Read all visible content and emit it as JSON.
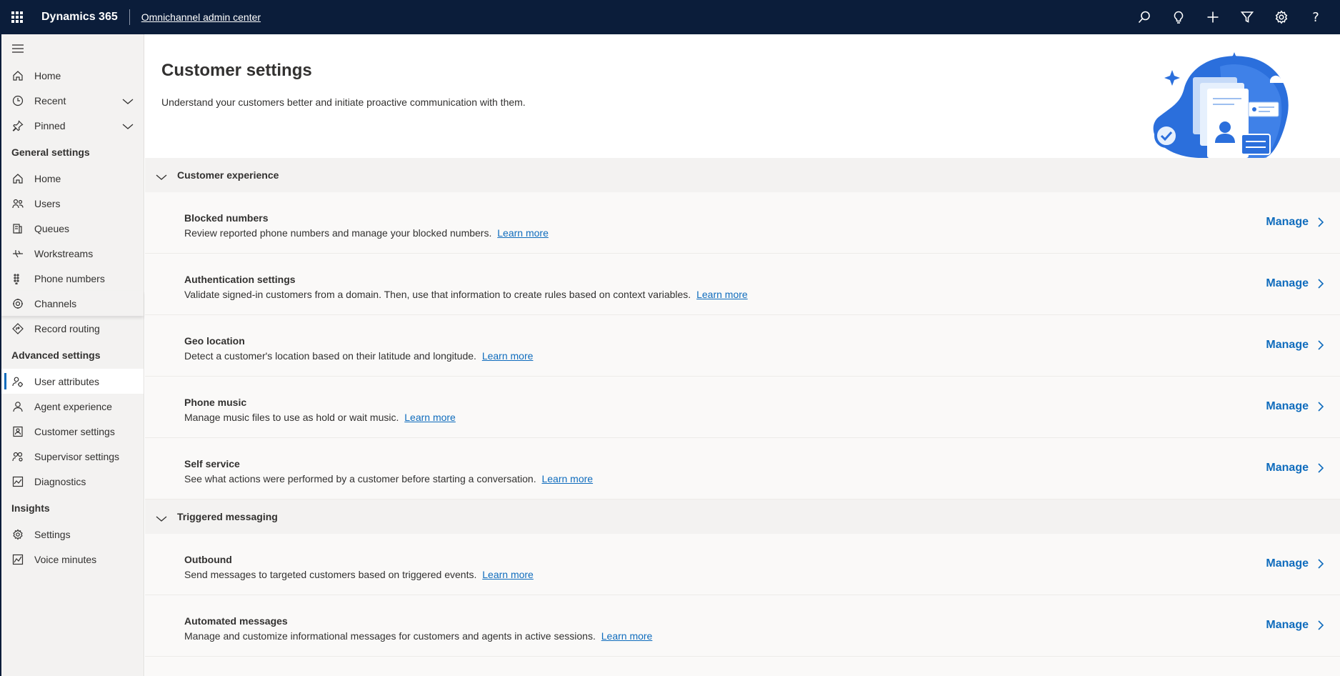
{
  "topbar": {
    "brand": "Dynamics 365",
    "app_name": "Omnichannel admin center",
    "icons": [
      "search-icon",
      "lightbulb-icon",
      "plus-icon",
      "filter-icon",
      "gear-icon",
      "help-icon"
    ],
    "help_glyph": "?"
  },
  "sidebar": {
    "top_items": [
      {
        "label": "Home",
        "icon": "home-icon"
      },
      {
        "label": "Recent",
        "icon": "clock-icon"
      },
      {
        "label": "Pinned",
        "icon": "pin-icon"
      }
    ],
    "general_title": "General settings",
    "general_items": [
      {
        "label": "Home",
        "icon": "home-icon"
      },
      {
        "label": "Users",
        "icon": "users-icon"
      },
      {
        "label": "Queues",
        "icon": "queues-icon"
      },
      {
        "label": "Workstreams",
        "icon": "workstreams-icon"
      },
      {
        "label": "Phone numbers",
        "icon": "dialpad-icon"
      },
      {
        "label": "Channels",
        "icon": "channels-icon"
      },
      {
        "label": "Record routing",
        "icon": "routing-icon"
      }
    ],
    "advanced_title": "Advanced settings",
    "advanced_items": [
      {
        "label": "User attributes",
        "icon": "user-attributes-icon",
        "selected": true
      },
      {
        "label": "Agent experience",
        "icon": "agent-icon"
      },
      {
        "label": "Customer settings",
        "icon": "customer-icon"
      },
      {
        "label": "Supervisor settings",
        "icon": "supervisor-icon"
      },
      {
        "label": "Diagnostics",
        "icon": "diagnostics-icon"
      }
    ],
    "insights_title": "Insights",
    "insights_items": [
      {
        "label": "Settings",
        "icon": "settings-icon"
      },
      {
        "label": "Voice minutes",
        "icon": "chart-icon"
      }
    ]
  },
  "page": {
    "title": "Customer settings",
    "subtitle": "Understand your customers better and initiate proactive communication with them."
  },
  "sections": [
    {
      "title": "Customer experience",
      "rows": [
        {
          "title": "Blocked numbers",
          "desc": "Review reported phone numbers and manage your blocked numbers.",
          "link": "Learn more",
          "action": "Manage"
        },
        {
          "title": "Authentication settings",
          "desc": "Validate signed-in customers from a domain. Then, use that information to create rules based on context variables.",
          "link": "Learn more",
          "action": "Manage"
        },
        {
          "title": "Geo location",
          "desc": "Detect a customer's location based on their latitude and longitude.",
          "link": "Learn more",
          "action": "Manage"
        },
        {
          "title": "Phone music",
          "desc": "Manage music files to use as hold or wait music.",
          "link": "Learn more",
          "action": "Manage"
        },
        {
          "title": "Self service",
          "desc": "See what actions were performed by a customer before starting a conversation.",
          "link": "Learn more",
          "action": "Manage"
        }
      ]
    },
    {
      "title": "Triggered messaging",
      "rows": [
        {
          "title": "Outbound",
          "desc": "Send messages to targeted customers based on triggered events.",
          "link": "Learn more",
          "action": "Manage"
        },
        {
          "title": "Automated messages",
          "desc": "Manage and customize informational messages for customers and agents in active sessions.",
          "link": "Learn more",
          "action": "Manage"
        }
      ]
    }
  ],
  "colors": {
    "topbar": "#0b1d3a",
    "accent": "#0f6cbd",
    "sidebar_bg": "#f3f2f1"
  }
}
